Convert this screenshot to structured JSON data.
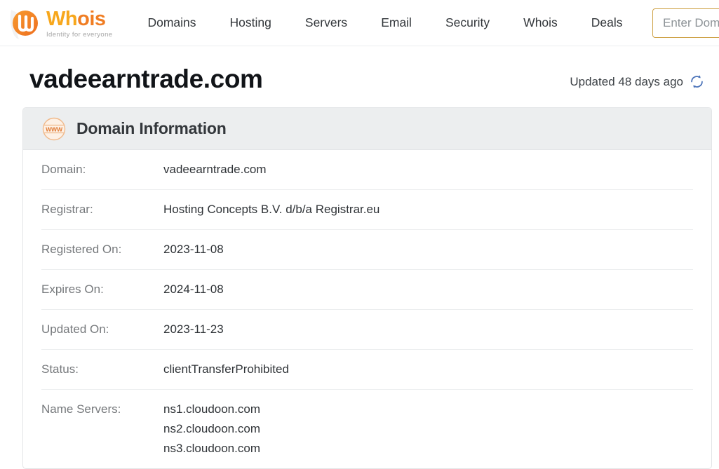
{
  "header": {
    "brand": {
      "name_part1": "Wh",
      "name_part2": "o",
      "name_part3": "is",
      "tagline": "Identity for everyone",
      "logo_icon": "whois-circle-logo-icon"
    },
    "nav": [
      {
        "label": "Domains",
        "name": "nav-domains"
      },
      {
        "label": "Hosting",
        "name": "nav-hosting"
      },
      {
        "label": "Servers",
        "name": "nav-servers"
      },
      {
        "label": "Email",
        "name": "nav-email"
      },
      {
        "label": "Security",
        "name": "nav-security"
      },
      {
        "label": "Whois",
        "name": "nav-whois"
      },
      {
        "label": "Deals",
        "name": "nav-deals"
      }
    ],
    "search": {
      "placeholder": "Enter Domain Name",
      "value": ""
    },
    "colors": {
      "brand_yellow": "#f7a71c",
      "brand_orange": "#f07d23",
      "search_border": "#cfa349"
    }
  },
  "page": {
    "title": "vadeearntrade.com",
    "updated_text": "Updated 48 days ago",
    "refresh_icon": "refresh-icon",
    "refresh_icon_color": "#4a72b8"
  },
  "card": {
    "icon": "www-globe-icon",
    "title": "Domain Information",
    "rows": [
      {
        "label": "Domain:",
        "value": "vadeearntrade.com"
      },
      {
        "label": "Registrar:",
        "value": "Hosting Concepts B.V. d/b/a Registrar.eu"
      },
      {
        "label": "Registered On:",
        "value": "2023-11-08"
      },
      {
        "label": "Expires On:",
        "value": "2024-11-08"
      },
      {
        "label": "Updated On:",
        "value": "2023-11-23"
      },
      {
        "label": "Status:",
        "value": "clientTransferProhibited"
      }
    ],
    "name_servers": {
      "label": "Name Servers:",
      "values": [
        "ns1.cloudoon.com",
        "ns2.cloudoon.com",
        "ns3.cloudoon.com"
      ]
    }
  }
}
